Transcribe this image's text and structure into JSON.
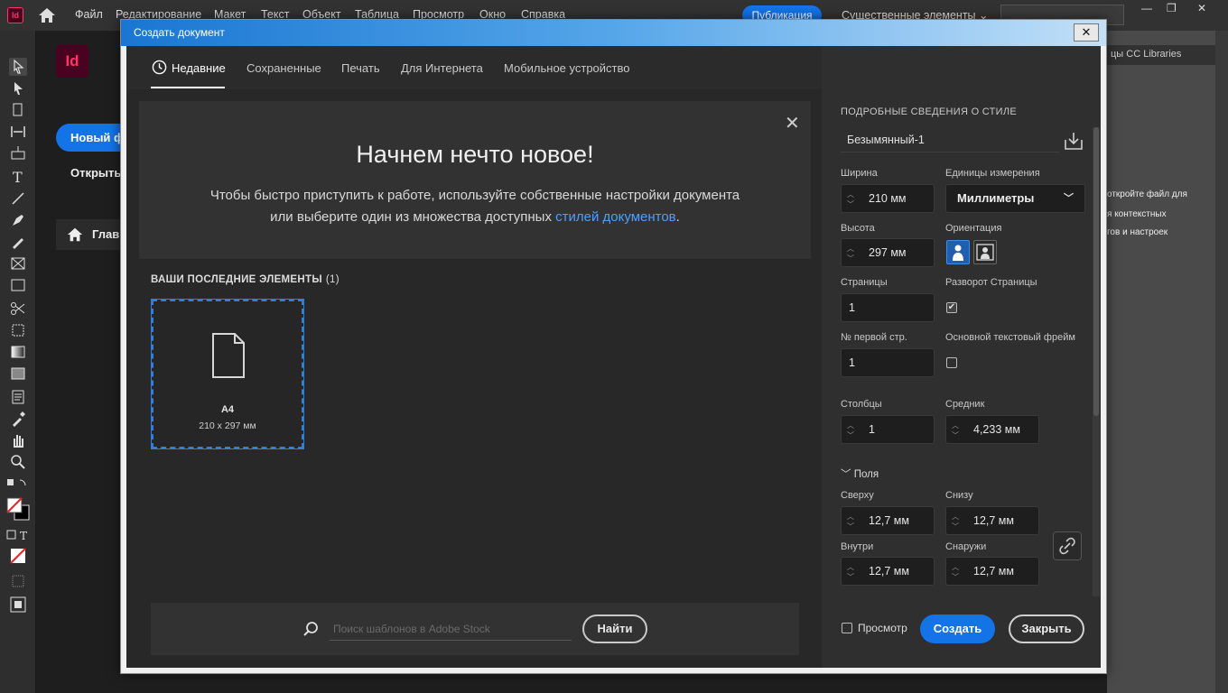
{
  "app": {
    "logo": "Id",
    "menu": [
      "Файл",
      "Редактирование",
      "Макет",
      "Текст",
      "Объект",
      "Таблица",
      "Просмотр",
      "Окно",
      "Справка"
    ],
    "publish_label": "Публикация",
    "workspace_label": "Существенные элементы",
    "window_controls": [
      "—",
      "❐",
      "✕"
    ]
  },
  "left_pane": {
    "logo": "Id",
    "new_file_label": "Новый ф",
    "open_label": "Открыть",
    "home_label": "Главн"
  },
  "right_panel": {
    "tabs_label": "цы   CC Libraries",
    "line1": "откройте файл для",
    "line2": "я контекстных",
    "line3": "гов и настроек"
  },
  "dialog": {
    "title": "Создать документ",
    "close": "✕",
    "tabs": [
      "Недавние",
      "Сохраненные",
      "Печать",
      "Для Интернета",
      "Мобильное устройство"
    ],
    "active_tab": "Недавние",
    "banner": {
      "title": "Начнем нечто новое!",
      "text": "Чтобы быстро приступить к работе, используйте собственные настройки документа или выберите один из множества доступных ",
      "link": "стилей документов",
      "text_end": ".",
      "close": "✕"
    },
    "recent": {
      "label": "ВАШИ ПОСЛЕДНИЕ ЭЛЕМЕНТЫ",
      "count": "(1)",
      "items": [
        {
          "name": "A4",
          "size": "210 x 297 мм"
        }
      ]
    },
    "search": {
      "placeholder": "Поиск шаблонов в Adobe Stock",
      "find_label": "Найти"
    },
    "details": {
      "header": "ПОДРОБНЫЕ СВЕДЕНИЯ О СТИЛЕ",
      "preset_name": "Безымянный-1",
      "width_label": "Ширина",
      "width": "210 мм",
      "units_label": "Единицы измерения",
      "units": "Миллиметры",
      "height_label": "Высота",
      "height": "297 мм",
      "orientation_label": "Ориентация",
      "orientation": "portrait",
      "pages_label": "Страницы",
      "pages": "1",
      "facing_label": "Разворот Страницы",
      "facing_checked": "✔",
      "start_label": "№ первой стр.",
      "start": "1",
      "primary_frame_label": "Основной текстовый фрейм",
      "columns_label": "Столбцы",
      "columns": "1",
      "gutter_label": "Средник",
      "gutter": "4,233 мм",
      "margins_label": "Поля",
      "top_label": "Сверху",
      "top": "12,7 мм",
      "bottom_label": "Снизу",
      "bottom": "12,7 мм",
      "inside_label": "Внутри",
      "inside": "12,7 мм",
      "outside_label": "Снаружи",
      "outside": "12,7 мм",
      "preview_label": "Просмотр",
      "create_label": "Создать",
      "close_label": "Закрыть"
    }
  }
}
